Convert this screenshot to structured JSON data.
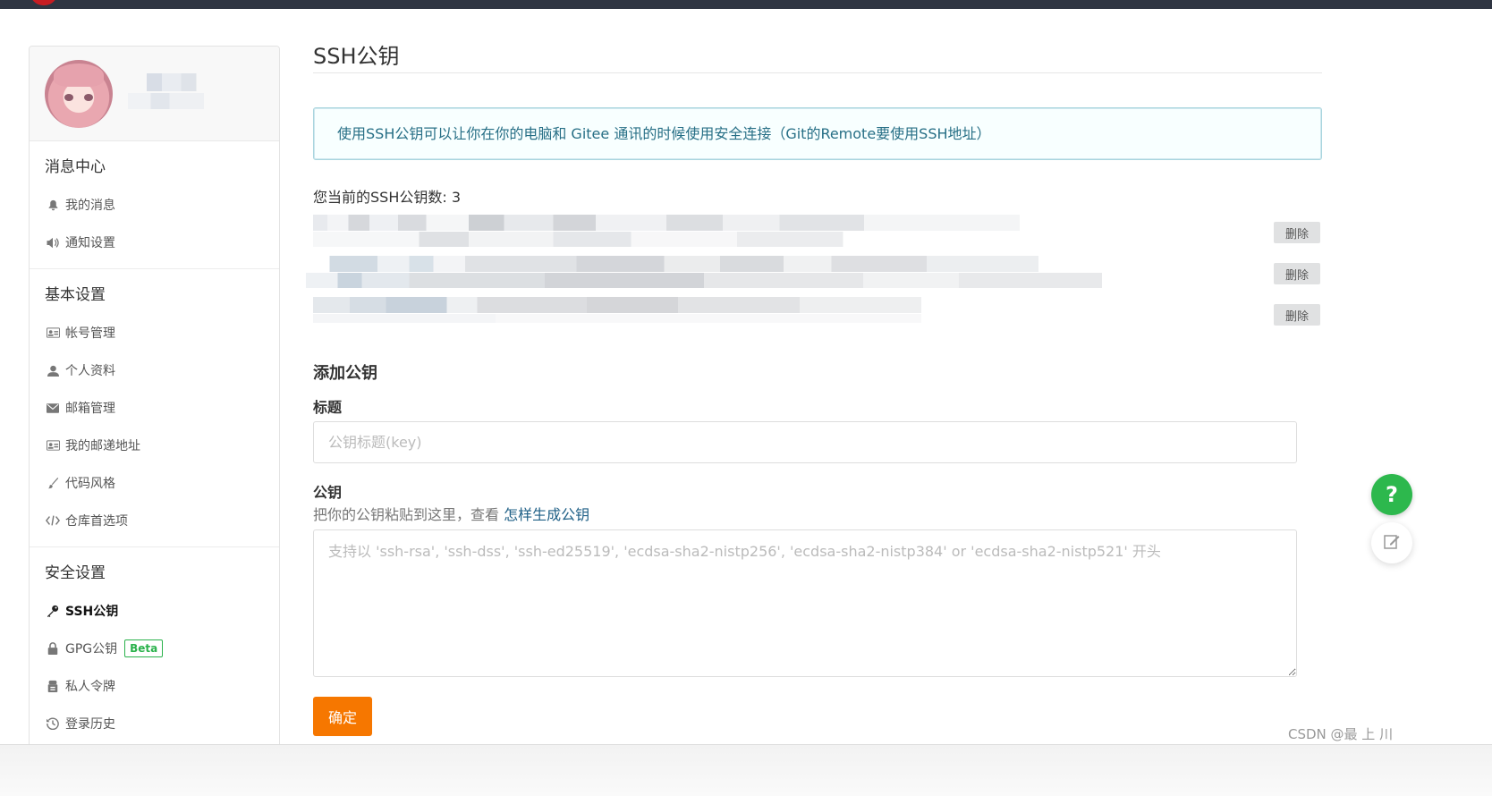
{
  "sidebar": {
    "sections": [
      {
        "title": "消息中心",
        "items": [
          {
            "label": "我的消息",
            "icon": "bell-icon"
          },
          {
            "label": "通知设置",
            "icon": "speaker-icon"
          }
        ]
      },
      {
        "title": "基本设置",
        "items": [
          {
            "label": "帐号管理",
            "icon": "id-card-icon"
          },
          {
            "label": "个人资料",
            "icon": "user-icon"
          },
          {
            "label": "邮箱管理",
            "icon": "envelope-icon"
          },
          {
            "label": "我的邮递地址",
            "icon": "address-card-icon"
          },
          {
            "label": "代码风格",
            "icon": "brush-icon"
          },
          {
            "label": "仓库首选项",
            "icon": "code-icon"
          }
        ]
      },
      {
        "title": "安全设置",
        "items": [
          {
            "label": "SSH公钥",
            "icon": "key-icon",
            "active": true
          },
          {
            "label": "GPG公钥",
            "icon": "lock-icon",
            "badge": "Beta"
          },
          {
            "label": "私人令牌",
            "icon": "token-icon"
          },
          {
            "label": "登录历史",
            "icon": "history-icon"
          }
        ]
      }
    ]
  },
  "main": {
    "title": "SSH公钥",
    "info": "使用SSH公钥可以让你在你的电脑和 Gitee 通讯的时候使用安全连接（Git的Remote要使用SSH地址）",
    "count_text": "您当前的SSH公钥数: 3",
    "delete_label": "删除",
    "add": {
      "title": "添加公钥",
      "title_label": "标题",
      "title_placeholder": "公钥标题(key)",
      "key_label": "公钥",
      "hint_prefix": "把你的公钥粘贴到这里，查看 ",
      "hint_link": "怎样生成公钥",
      "key_placeholder": "支持以 'ssh-rsa', 'ssh-dss', 'ssh-ed25519', 'ecdsa-sha2-nistp256', 'ecdsa-sha2-nistp384' or 'ecdsa-sha2-nistp521' 开头",
      "submit_label": "确定"
    }
  },
  "float": {
    "help": "?"
  },
  "watermark": "CSDN @最 上 川",
  "colors": {
    "accent": "#f67700",
    "help": "#2db84d",
    "link": "#1e5f86",
    "beta": "#2bb24c"
  }
}
